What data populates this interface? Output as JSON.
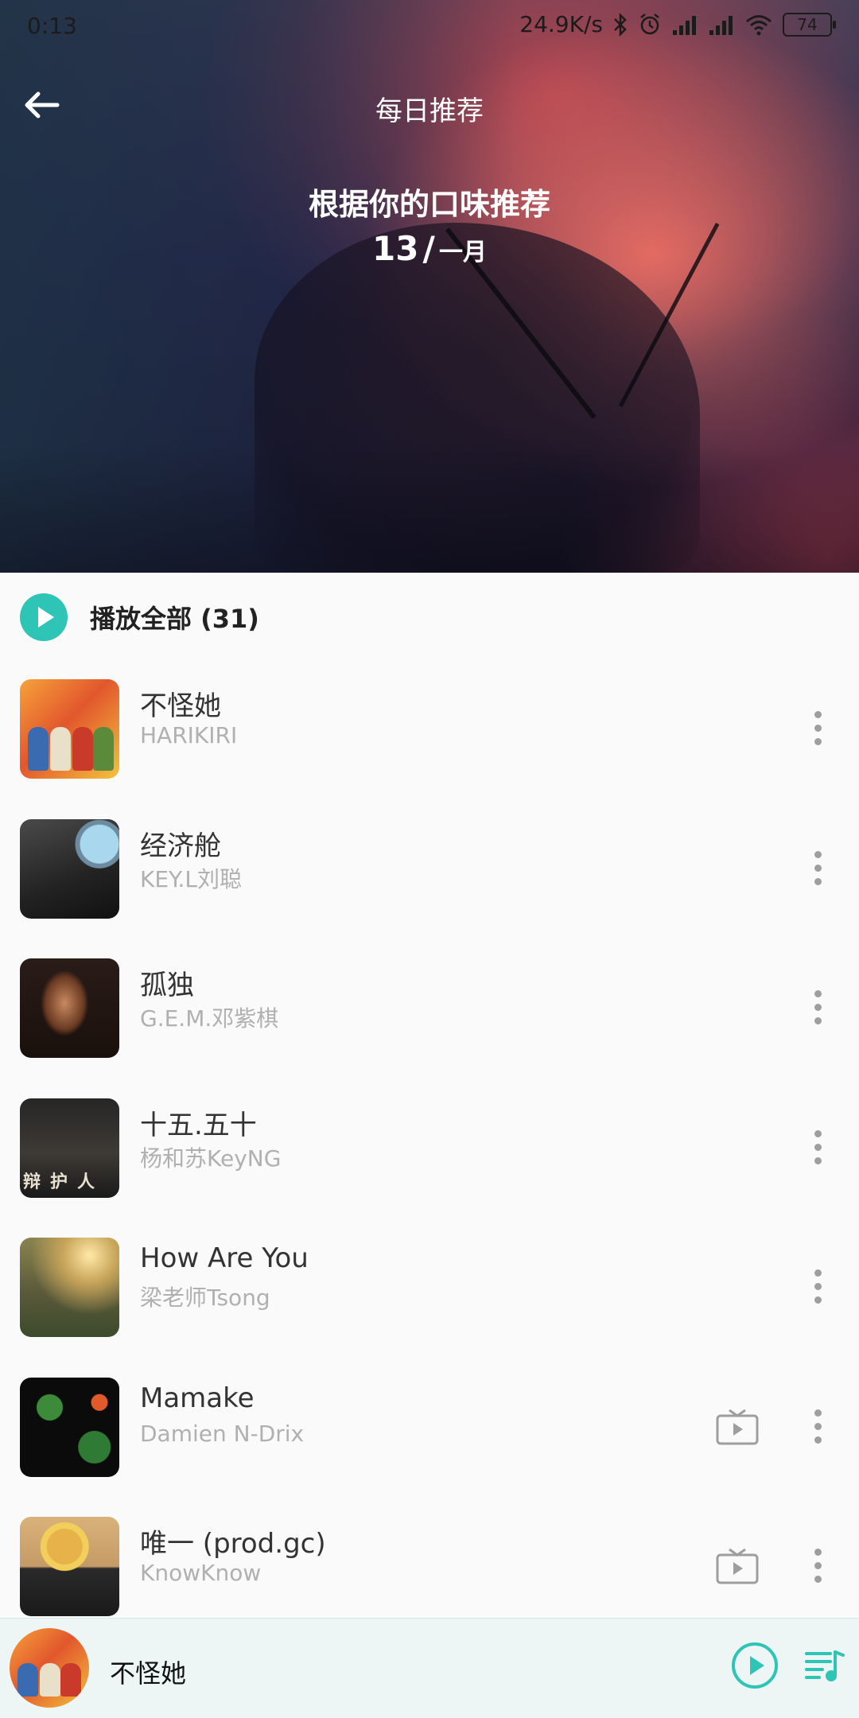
{
  "status_bar": {
    "time": "0:13",
    "speed": "24.9K/s",
    "battery": "74",
    "icons": [
      "bluetooth-icon",
      "alarm-icon",
      "hd-signal-icon",
      "hd-signal-icon",
      "wifi-icon",
      "battery-icon"
    ]
  },
  "header": {
    "nav_title": "每日推荐",
    "subtitle": "根据你的口味推荐",
    "day": "13",
    "separator": "/",
    "month": "一月"
  },
  "play_all": {
    "label": "播放全部 (31)"
  },
  "songs": [
    {
      "title": "不怪她",
      "artist": "HARIKIRI",
      "has_mv": false
    },
    {
      "title": "经济舱",
      "artist": "KEY.L刘聪",
      "has_mv": false
    },
    {
      "title": "孤独",
      "artist": "G.E.M.邓紫棋",
      "has_mv": false
    },
    {
      "title": "十五.五十",
      "artist": "杨和苏KeyNG",
      "has_mv": false
    },
    {
      "title": "How Are You",
      "artist": "梁老师Tsong",
      "has_mv": false
    },
    {
      "title": "Mamake",
      "artist": "Damien N-Drix",
      "has_mv": true
    },
    {
      "title": "唯一 (prod.gc)",
      "artist": "KnowKnow",
      "has_mv": true
    }
  ],
  "cover_text": {
    "c4": "辩护人"
  },
  "player": {
    "current_song": "不怪她"
  },
  "colors": {
    "accent": "#2ec4b6",
    "artist_text": "#b0b0b0"
  }
}
